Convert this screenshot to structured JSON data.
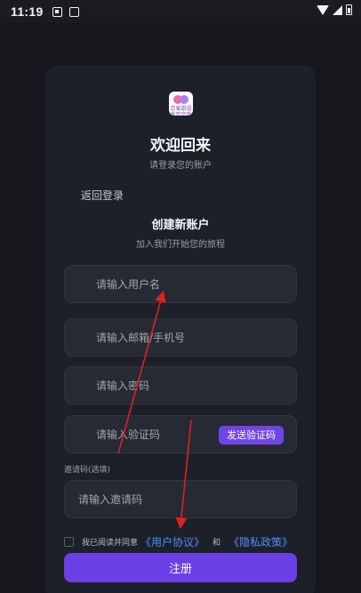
{
  "status_bar": {
    "time": "11:19",
    "icons": [
      "notification-a-icon",
      "screen-icon",
      "wifi-icon",
      "signal-icon",
      "battery-icon"
    ]
  },
  "logo": {
    "text": "恋爱甜语\n爱恋恋我"
  },
  "header": {
    "title": "欢迎回来",
    "subtitle": "请登录您的账户"
  },
  "back_link": "返回登录",
  "register_section": {
    "title": "创建新账户",
    "subtitle": "加入我们开始您的旅程"
  },
  "fields": {
    "username": {
      "placeholder": "请输入用户名",
      "value": ""
    },
    "email_phone": {
      "placeholder": "请输入邮箱/手机号",
      "value": ""
    },
    "password": {
      "placeholder": "请输入密码",
      "value": ""
    },
    "code": {
      "placeholder": "请输入验证码",
      "value": ""
    },
    "invite": {
      "label": "邀请码(选填)",
      "placeholder": "请输入邀请码",
      "value": ""
    }
  },
  "send_code_label": "发送验证码",
  "agreement": {
    "prefix": "我已阅读并同意",
    "user_agreement": "《用户协议》",
    "and": "和",
    "privacy_policy": "《隐私政策》"
  },
  "register_label": "注册",
  "colors": {
    "background": "#16171c",
    "card": "#1d2029",
    "accent": "#6b3fe6",
    "link": "#4a8ff7",
    "annotation_arrow": "#e02020"
  }
}
